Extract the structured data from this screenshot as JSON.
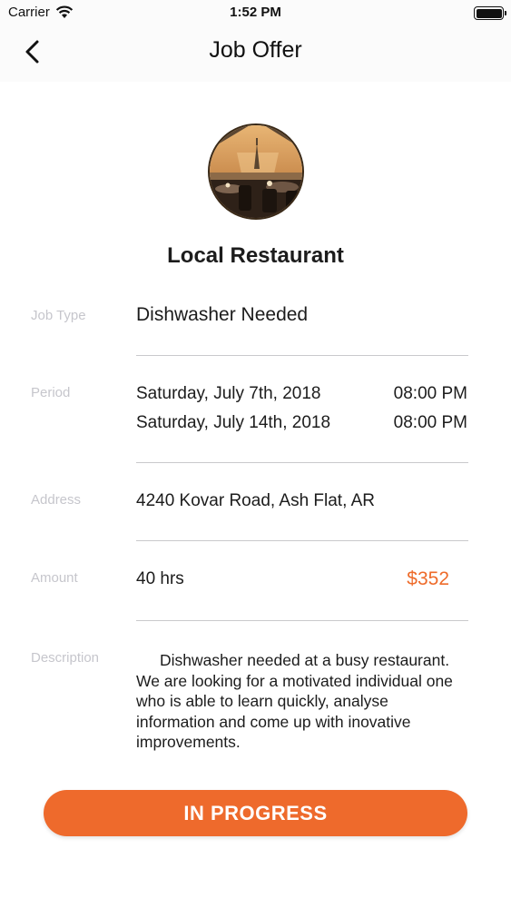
{
  "status_bar": {
    "carrier": "Carrier",
    "time": "1:52 PM",
    "wifi_icon": "wifi-icon",
    "battery_icon": "battery-icon"
  },
  "nav": {
    "back_icon": "chevron-left-icon",
    "title": "Job Offer"
  },
  "business": {
    "name": "Local Restaurant"
  },
  "job_type": {
    "label": "Job Type",
    "value": "Dishwasher Needed"
  },
  "period": {
    "label": "Period",
    "start_date": "Saturday, July 7th, 2018",
    "start_time": "08:00 PM",
    "end_date": "Saturday, July 14th, 2018",
    "end_time": "08:00 PM"
  },
  "address": {
    "label": "Address",
    "value": "4240 Kovar Road, Ash Flat, AR"
  },
  "amount": {
    "label": "Amount",
    "hours": "40 hrs",
    "price": "$352"
  },
  "description": {
    "label": "Description",
    "text": "Dishwasher needed at a busy restaurant. We are looking for a motivated individual one who is able to learn quickly, analyse information and come up with inovative improvements."
  },
  "status_button": {
    "label": "IN PROGRESS"
  },
  "colors": {
    "accent": "#ee6a2c",
    "label_gray": "#c6c6cc",
    "divider": "#c9c9cc"
  }
}
